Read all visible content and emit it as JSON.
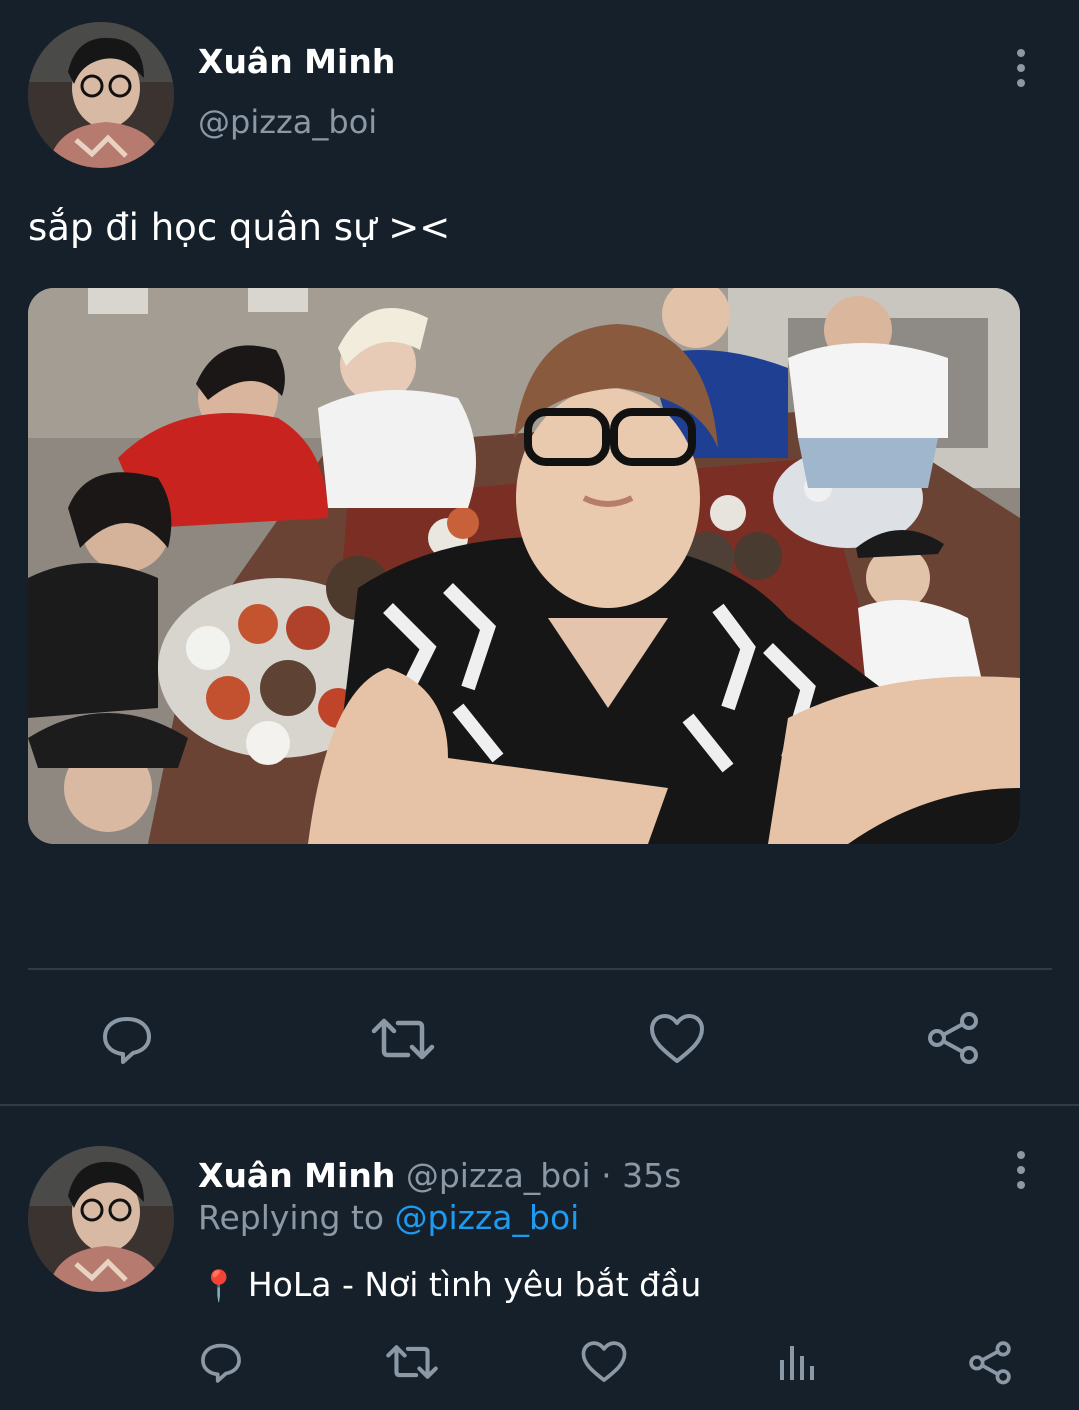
{
  "tweet": {
    "author_name": "Xuân Minh",
    "author_handle": "@pizza_boi",
    "text": "sắp đi học quân sự ><"
  },
  "reply": {
    "author_name": "Xuân Minh",
    "author_handle": "@pizza_boi",
    "separator": "·",
    "time": "35s",
    "replying_prefix": "Replying to",
    "replying_handle": "@pizza_boi",
    "pin": "📍",
    "text": "HoLa - Nơi tình yêu bắt đầu"
  },
  "icons": {
    "comment": "comment-icon",
    "retweet": "retweet-icon",
    "like": "heart-icon",
    "share": "share-icon",
    "analytics": "analytics-icon",
    "more": "more-vertical-icon",
    "pin": "location-pin-icon"
  },
  "colors": {
    "background": "#15202b",
    "text": "#ffffff",
    "secondary": "#8b98a5",
    "link": "#1d9bf0",
    "divider": "#2f3b47"
  }
}
